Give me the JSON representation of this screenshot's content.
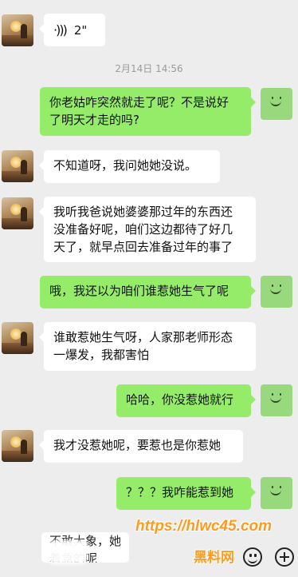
{
  "timestamp": "2月14日 14:56",
  "messages": [
    {
      "side": "in",
      "voice_icon": "voice-wave-icon",
      "voice_duration": "2\""
    },
    {
      "side": "out",
      "text_lines": [
        "你老姑咋突然就走了呢？不是说好",
        "了明天才走的吗?"
      ]
    },
    {
      "side": "in",
      "text_lines": [
        "不知道呀，我问她她没说。"
      ]
    },
    {
      "side": "in",
      "text_lines": [
        "我听我爸说她婆婆那过年的东西还",
        "没准备好呢，咱们这边都待了好几",
        "天了，就早点回去准备过年的事了"
      ]
    },
    {
      "side": "out",
      "text_lines": [
        "哦，我还以为咱们谁惹她生气了呢"
      ]
    },
    {
      "side": "in",
      "text_lines": [
        "谁敢惹她生气呀，人家那老师形态",
        "一爆发，我都害怕"
      ]
    },
    {
      "side": "out",
      "text_lines": [
        "哈哈，你没惹她就行"
      ]
    },
    {
      "side": "in",
      "text_lines": [
        "我才没惹她呢，要惹也是你惹她"
      ]
    },
    {
      "side": "out",
      "text_lines": [
        "？？？我咋能惹到她"
      ]
    }
  ],
  "cropped_message": "不敢大象，她着急的呢",
  "watermark": {
    "url": "https://hlwc45.com",
    "site": "黑料网"
  },
  "colors": {
    "background": "#ededed",
    "out_bubble": "#95ec69",
    "in_bubble": "#ffffff",
    "watermark": "#ff9a1f"
  }
}
